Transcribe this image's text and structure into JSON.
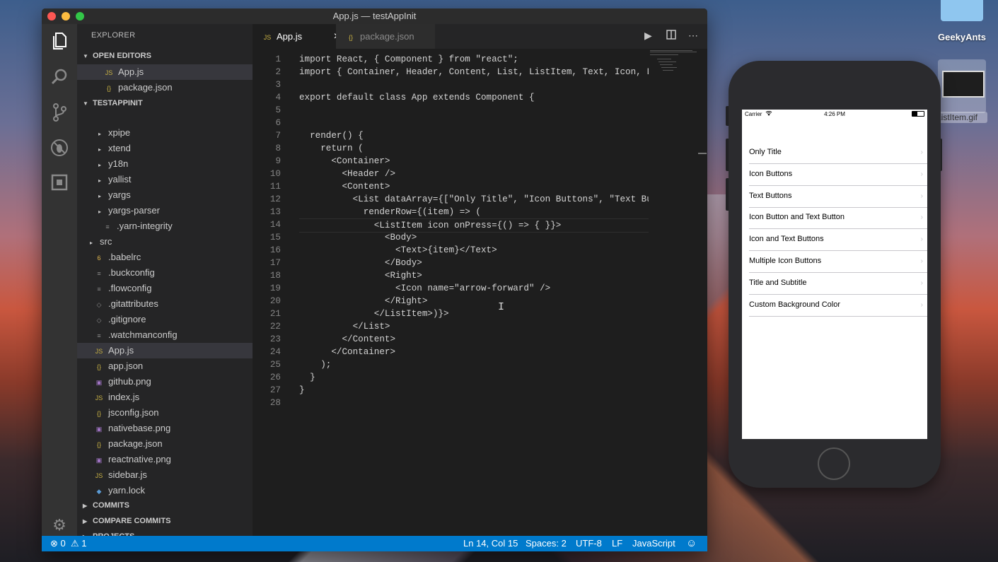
{
  "desktop": {
    "folder_label": "GeekyAnts",
    "gif_label": "ListItem.gif"
  },
  "window": {
    "title": "App.js — testAppInit",
    "traffic": [
      "#fc5753",
      "#fdbc40",
      "#33c748"
    ]
  },
  "activity": {
    "icons": [
      "files-icon",
      "search-icon",
      "source-control-icon",
      "debug-icon",
      "extensions-icon",
      "gear-icon"
    ]
  },
  "sidebar": {
    "header": "EXPLORER",
    "open_editors_label": "OPEN EDITORS",
    "open_editors": [
      {
        "icon": "JS",
        "name": "App.js"
      },
      {
        "icon": "{}",
        "name": "package.json"
      }
    ],
    "project_label": "TESTAPPINIT",
    "tree": [
      {
        "icon": "▸",
        "name": "xpipe",
        "indent": 2
      },
      {
        "icon": "▸",
        "name": "xtend",
        "indent": 2
      },
      {
        "icon": "▸",
        "name": "y18n",
        "indent": 2
      },
      {
        "icon": "▸",
        "name": "yallist",
        "indent": 2
      },
      {
        "icon": "▸",
        "name": "yargs",
        "indent": 2
      },
      {
        "icon": "▸",
        "name": "yargs-parser",
        "indent": 2
      },
      {
        "icon": "≡",
        "name": ".yarn-integrity",
        "indent": 2
      },
      {
        "icon": "▸",
        "name": "src",
        "indent": 1
      },
      {
        "icon": "6",
        "name": ".babelrc",
        "indent": 1
      },
      {
        "icon": "≡",
        "name": ".buckconfig",
        "indent": 1
      },
      {
        "icon": "≡",
        "name": ".flowconfig",
        "indent": 1
      },
      {
        "icon": "◇",
        "name": ".gitattributes",
        "indent": 1
      },
      {
        "icon": "◇",
        "name": ".gitignore",
        "indent": 1
      },
      {
        "icon": "≡",
        "name": ".watchmanconfig",
        "indent": 1
      },
      {
        "icon": "JS",
        "name": "App.js",
        "indent": 1
      },
      {
        "icon": "{}",
        "name": "app.json",
        "indent": 1
      },
      {
        "icon": "▣",
        "name": "github.png",
        "indent": 1
      },
      {
        "icon": "JS",
        "name": "index.js",
        "indent": 1
      },
      {
        "icon": "{}",
        "name": "jsconfig.json",
        "indent": 1
      },
      {
        "icon": "▣",
        "name": "nativebase.png",
        "indent": 1
      },
      {
        "icon": "{}",
        "name": "package.json",
        "indent": 1
      },
      {
        "icon": "▣",
        "name": "reactnative.png",
        "indent": 1
      },
      {
        "icon": "JS",
        "name": "sidebar.js",
        "indent": 1
      },
      {
        "icon": "◆",
        "name": "yarn.lock",
        "indent": 1
      }
    ],
    "bottom_sections": [
      "COMMITS",
      "COMPARE COMMITS",
      "PROJECTS"
    ]
  },
  "tabs": [
    {
      "icon": "JS",
      "label": "App.js",
      "close": "×"
    },
    {
      "icon": "{}",
      "label": "package.json"
    }
  ],
  "code_lines": [
    "import React, { Component } from \"react\";",
    "import { Container, Header, Content, List, ListItem, Text, Icon, Left, Body, Right } from \"native-base\";",
    "",
    "export default class App extends Component {",
    "",
    "",
    "  render() {",
    "    return (",
    "      <Container>",
    "        <Header />",
    "        <Content>",
    "          <List dataArray={[\"Only Title\", \"Icon Buttons\", \"Text Buttons\"]}",
    "            renderRow={(item) => (",
    "              <ListItem icon onPress={() => { }}>",
    "                <Body>",
    "                  <Text>{item}</Text>",
    "                </Body>",
    "                <Right>",
    "                  <Icon name=\"arrow-forward\" />",
    "                </Right>",
    "              </ListItem>)}>",
    "          </List>",
    "        </Content>",
    "      </Container>",
    "    );",
    "  }",
    "}",
    ""
  ],
  "status": {
    "errors": "0",
    "warnings": "1",
    "position": "Ln 14, Col 15",
    "spaces": "Spaces: 2",
    "encoding": "UTF-8",
    "eol": "LF",
    "language": "JavaScript"
  },
  "phone": {
    "carrier": "Carrier",
    "time": "4:26 PM",
    "items": [
      "Only Title",
      "Icon Buttons",
      "Text Buttons",
      "Icon Button and Text Button",
      "Icon and Text Buttons",
      "Multiple Icon Buttons",
      "Title and Subtitle",
      "Custom Background Color"
    ],
    "chevron": "›"
  }
}
